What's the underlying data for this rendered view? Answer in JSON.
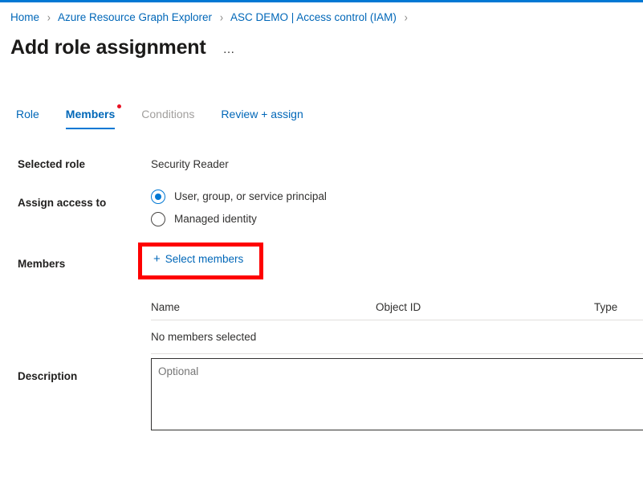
{
  "theme": {
    "accent": "#0078d4",
    "link": "#0067b8",
    "annotation": "#fe0000",
    "disabled_text": "#a19f9d",
    "border": "#e1dfdd"
  },
  "breadcrumb": {
    "separator": "›",
    "items": [
      {
        "label": "Home"
      },
      {
        "label": "Azure Resource Graph Explorer"
      },
      {
        "label": "ASC DEMO | Access control (IAM)"
      }
    ]
  },
  "header": {
    "title": "Add role assignment",
    "more_label": "…"
  },
  "tabs": [
    {
      "label": "Role",
      "state": "link"
    },
    {
      "label": "Members",
      "state": "active",
      "has_dot": true
    },
    {
      "label": "Conditions",
      "state": "disabled"
    },
    {
      "label": "Review + assign",
      "state": "link"
    }
  ],
  "form": {
    "selected_role": {
      "label": "Selected role",
      "value": "Security Reader"
    },
    "assign_access_to": {
      "label": "Assign access to",
      "options": [
        {
          "label": "User, group, or service principal",
          "checked": true
        },
        {
          "label": "Managed identity",
          "checked": false
        }
      ]
    },
    "members": {
      "label": "Members",
      "select_button": {
        "icon": "plus-icon",
        "plus": "+",
        "label": "Select members"
      },
      "table": {
        "columns": [
          "Name",
          "Object ID",
          "Type"
        ],
        "empty_row": "No members selected",
        "rows": []
      }
    },
    "description": {
      "label": "Description",
      "value": "",
      "placeholder": "Optional"
    }
  }
}
